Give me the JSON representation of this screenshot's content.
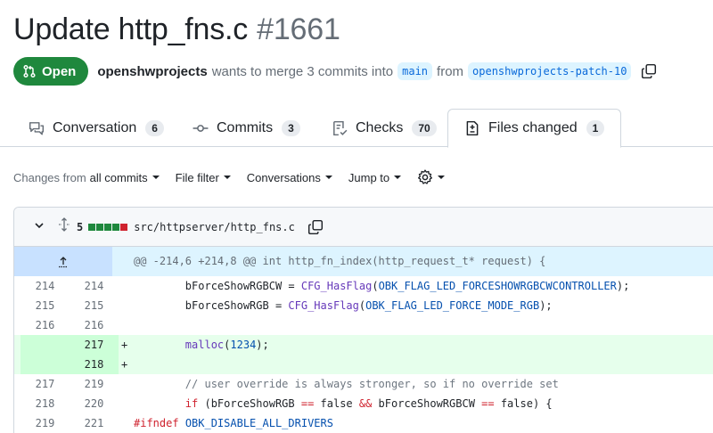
{
  "pr": {
    "title": "Update http_fns.c",
    "number": "#1661",
    "state": "Open",
    "author": "openshwprojects",
    "merge_text": "wants to merge 3 commits into",
    "base_branch": "main",
    "from_text": "from",
    "head_branch": "openshwprojects-patch-10"
  },
  "tabs": [
    {
      "label": "Conversation",
      "count": "6"
    },
    {
      "label": "Commits",
      "count": "3"
    },
    {
      "label": "Checks",
      "count": "70"
    },
    {
      "label": "Files changed",
      "count": "1"
    }
  ],
  "filters": {
    "changes_prefix": "Changes from",
    "changes_value": "all commits",
    "file_filter": "File filter",
    "conversations": "Conversations",
    "jump_to": "Jump to"
  },
  "file": {
    "changes": "5",
    "path": "src/httpserver/http_fns.c",
    "hunk": "@@ -214,6 +214,8 @@ int http_fn_index(http_request_t* request) {",
    "diffstat_colors": [
      "#1f883d",
      "#1f883d",
      "#1f883d",
      "#1f883d",
      "#cf222e"
    ],
    "lines": [
      {
        "old": "214",
        "new": "214",
        "sign": "",
        "type": "ctx",
        "tokens": [
          [
            "var",
            "        bForceShowRGBCW = "
          ],
          [
            "fn",
            "CFG_HasFlag"
          ],
          [
            "var",
            "("
          ],
          [
            "const",
            "OBK_FLAG_LED_FORCESHOWRGBCWCONTROLLER"
          ],
          [
            "var",
            ");"
          ]
        ]
      },
      {
        "old": "215",
        "new": "215",
        "sign": "",
        "type": "ctx",
        "tokens": [
          [
            "var",
            "        bForceShowRGB = "
          ],
          [
            "fn",
            "CFG_HasFlag"
          ],
          [
            "var",
            "("
          ],
          [
            "const",
            "OBK_FLAG_LED_FORCE_MODE_RGB"
          ],
          [
            "var",
            ");"
          ]
        ]
      },
      {
        "old": "216",
        "new": "216",
        "sign": "",
        "type": "ctx",
        "tokens": []
      },
      {
        "old": "",
        "new": "217",
        "sign": "+",
        "type": "add",
        "tokens": [
          [
            "var",
            "        "
          ],
          [
            "fn",
            "malloc"
          ],
          [
            "var",
            "("
          ],
          [
            "const",
            "1234"
          ],
          [
            "var",
            ");"
          ]
        ]
      },
      {
        "old": "",
        "new": "218",
        "sign": "+",
        "type": "add",
        "tokens": []
      },
      {
        "old": "217",
        "new": "219",
        "sign": "",
        "type": "ctx",
        "tokens": [
          [
            "cm",
            "        // user override is always stronger, so if no override set"
          ]
        ]
      },
      {
        "old": "218",
        "new": "220",
        "sign": "",
        "type": "ctx",
        "tokens": [
          [
            "kw",
            "        if"
          ],
          [
            "var",
            " (bForceShowRGB "
          ],
          [
            "kw",
            "=="
          ],
          [
            "var",
            " false "
          ],
          [
            "kw",
            "&&"
          ],
          [
            "var",
            " bForceShowRGBCW "
          ],
          [
            "kw",
            "=="
          ],
          [
            "var",
            " false) {"
          ]
        ]
      },
      {
        "old": "219",
        "new": "221",
        "sign": "",
        "type": "ctx",
        "tokens": [
          [
            "kw",
            "#ifndef"
          ],
          [
            "var",
            " "
          ],
          [
            "const",
            "OBK_DISABLE_ALL_DRIVERS"
          ]
        ]
      }
    ]
  }
}
